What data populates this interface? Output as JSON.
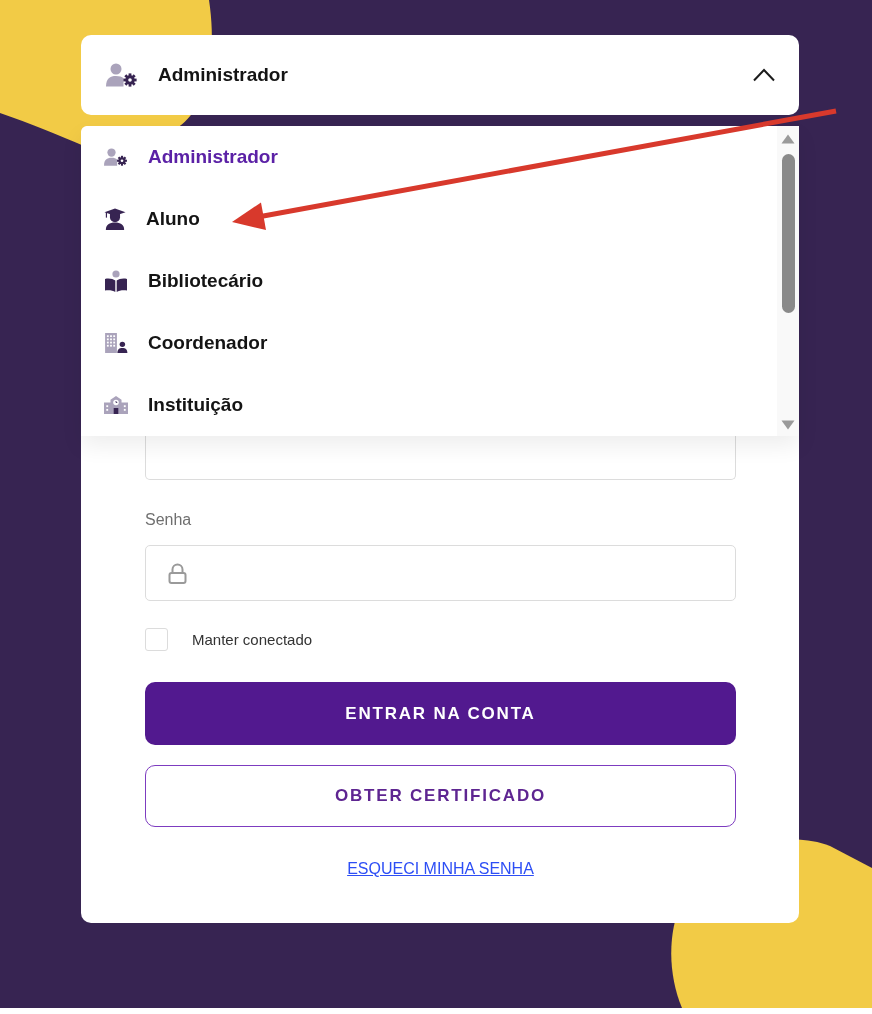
{
  "role_select": {
    "value": "Administrador",
    "expanded": true,
    "options": [
      {
        "label": "Administrador",
        "selected": true
      },
      {
        "label": "Aluno",
        "selected": false
      },
      {
        "label": "Bibliotecário",
        "selected": false
      },
      {
        "label": "Coordenador",
        "selected": false
      },
      {
        "label": "Instituição",
        "selected": false
      }
    ]
  },
  "form": {
    "fields": [
      {
        "kind": "text"
      },
      {
        "kind": "password",
        "label": "Senha"
      }
    ],
    "remember": {
      "label": "Manter conectado",
      "checked": false
    },
    "buttons": [
      {
        "label": "ENTRAR NA CONTA",
        "kind": "primary"
      },
      {
        "label": "OBTER CERTIFICADO",
        "kind": "outline"
      }
    ],
    "forgot_link": "ESQUECI MINHA SENHA"
  }
}
